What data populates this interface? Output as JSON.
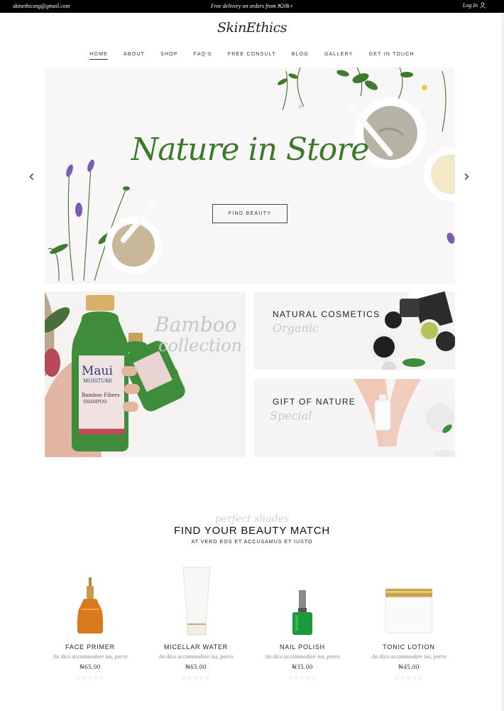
{
  "topbar": {
    "email": "skinethicsng@gmail.com",
    "promo": "Free delivery on orders from ₦20k+",
    "login": "Log In"
  },
  "brand": {
    "logo": "SkinEthics"
  },
  "nav": [
    {
      "label": "HOME",
      "active": true
    },
    {
      "label": "ABOUT"
    },
    {
      "label": "SHOP"
    },
    {
      "label": "FAQ'S"
    },
    {
      "label": "FREE CONSULT"
    },
    {
      "label": "BLOG"
    },
    {
      "label": "GALLERY"
    },
    {
      "label": "GET IN TOUCH"
    }
  ],
  "hero": {
    "title": "Nature in Store",
    "button": "FIND BEAUTY",
    "prev_icon": "chevron-left-icon",
    "next_icon": "chevron-right-icon"
  },
  "tiles": {
    "bamboo": {
      "script1": "Bamboo",
      "script2": "collection",
      "bottle_brand": "Maui",
      "bottle_sub": "MOISTURE",
      "bottle_line": "Bamboo Fibers",
      "bottle_type": "SHAMPOO"
    },
    "natural": {
      "heading": "NATURAL COSMETICS",
      "script": "Organic"
    },
    "gift": {
      "heading": "GIFT OF NATURE",
      "script": "Special"
    }
  },
  "section": {
    "script": "perfect shades",
    "title": "FIND YOUR BEAUTY MATCH",
    "subtitle": "AT VERO EOS ET ACCUSAMUS ET IUSTO"
  },
  "products": [
    {
      "name": "FACE PRIMER",
      "desc": "An dico accommodare ius, porro",
      "price": "₦65.00",
      "stars": "☆☆☆☆☆"
    },
    {
      "name": "MICELLAR WATER",
      "desc": "An dico accommodare ius, porro",
      "price": "₦65.00",
      "stars": "☆☆☆☆☆"
    },
    {
      "name": "NAIL POLISH",
      "desc": "An dico accommodare ius, porro",
      "price": "₦35.00",
      "stars": "☆☆☆☆☆"
    },
    {
      "name": "TONIC LOTION",
      "desc": "An dico accommodare ius, porro",
      "price": "₦45.00",
      "stars": "☆☆☆☆☆"
    }
  ],
  "colors": {
    "topbar": "#000000",
    "accent_green": "#3a7a2a",
    "muted_script": "#c9c5c5"
  }
}
